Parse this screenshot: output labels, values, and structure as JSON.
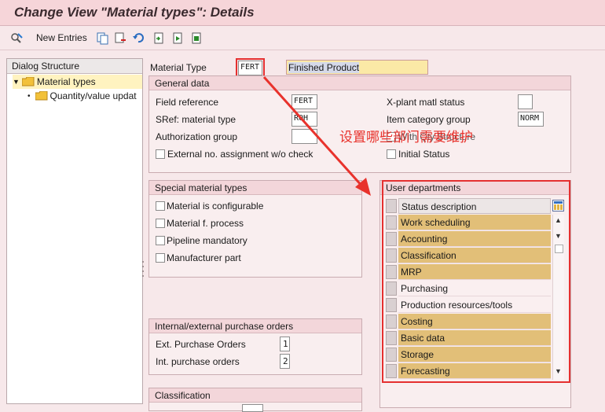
{
  "window": {
    "title": "Change View \"Material types\": Details"
  },
  "toolbar": {
    "new_entries_label": "New Entries",
    "icons": [
      "display-change-icon",
      "copy-icon",
      "delete-icon",
      "undo-icon",
      "select-all-icon",
      "select-block-icon",
      "deselect-all-icon"
    ]
  },
  "dialog_structure": {
    "header": "Dialog Structure",
    "items": [
      {
        "label": "Material types",
        "expanded": true,
        "selected": true
      },
      {
        "label": "Quantity/value updat",
        "expanded": false,
        "selected": false
      }
    ]
  },
  "header": {
    "material_type_label": "Material Type",
    "material_type_value": "FERT",
    "material_type_desc": "Finished Product"
  },
  "general_data": {
    "title": "General data",
    "field_reference_label": "Field reference",
    "field_reference_value": "FERT",
    "sref_label": "SRef: material type",
    "sref_value": "ROH",
    "auth_group_label": "Authorization group",
    "auth_group_value": "",
    "ext_no_label": "External no. assignment w/o check",
    "xplant_label": "X-plant matl status",
    "xplant_value": "",
    "item_cat_label": "Item category group",
    "item_cat_value": "NORM",
    "with_qty_label": "With Qty Structure",
    "initial_status_label": "Initial Status"
  },
  "special_types": {
    "title": "Special material types",
    "options": [
      "Material is configurable",
      "Material f. process",
      "Pipeline mandatory",
      "Manufacturer part"
    ]
  },
  "purchase_orders": {
    "title": "Internal/external purchase orders",
    "ext_label": "Ext. Purchase Orders",
    "ext_value": "1",
    "int_label": "Int. purchase orders",
    "int_value": "2"
  },
  "classification": {
    "title": "Classification"
  },
  "user_departments": {
    "title": "User departments",
    "column_header": "Status description",
    "rows": [
      {
        "label": "Work scheduling",
        "selected": true
      },
      {
        "label": "Accounting",
        "selected": true
      },
      {
        "label": "Classification",
        "selected": true
      },
      {
        "label": "MRP",
        "selected": true
      },
      {
        "label": "Purchasing",
        "selected": false
      },
      {
        "label": "Production resources/tools",
        "selected": false
      },
      {
        "label": "Costing",
        "selected": true
      },
      {
        "label": "Basic data",
        "selected": true
      },
      {
        "label": "Storage",
        "selected": true
      },
      {
        "label": "Forecasting",
        "selected": true
      }
    ]
  },
  "annotation": {
    "text": "设置哪些部门需要维护"
  },
  "colors": {
    "highlight": "#e53030",
    "selected_row": "#e2bf78",
    "unselected_row": "#faeff0",
    "desc_field": "#fbe9a6"
  }
}
